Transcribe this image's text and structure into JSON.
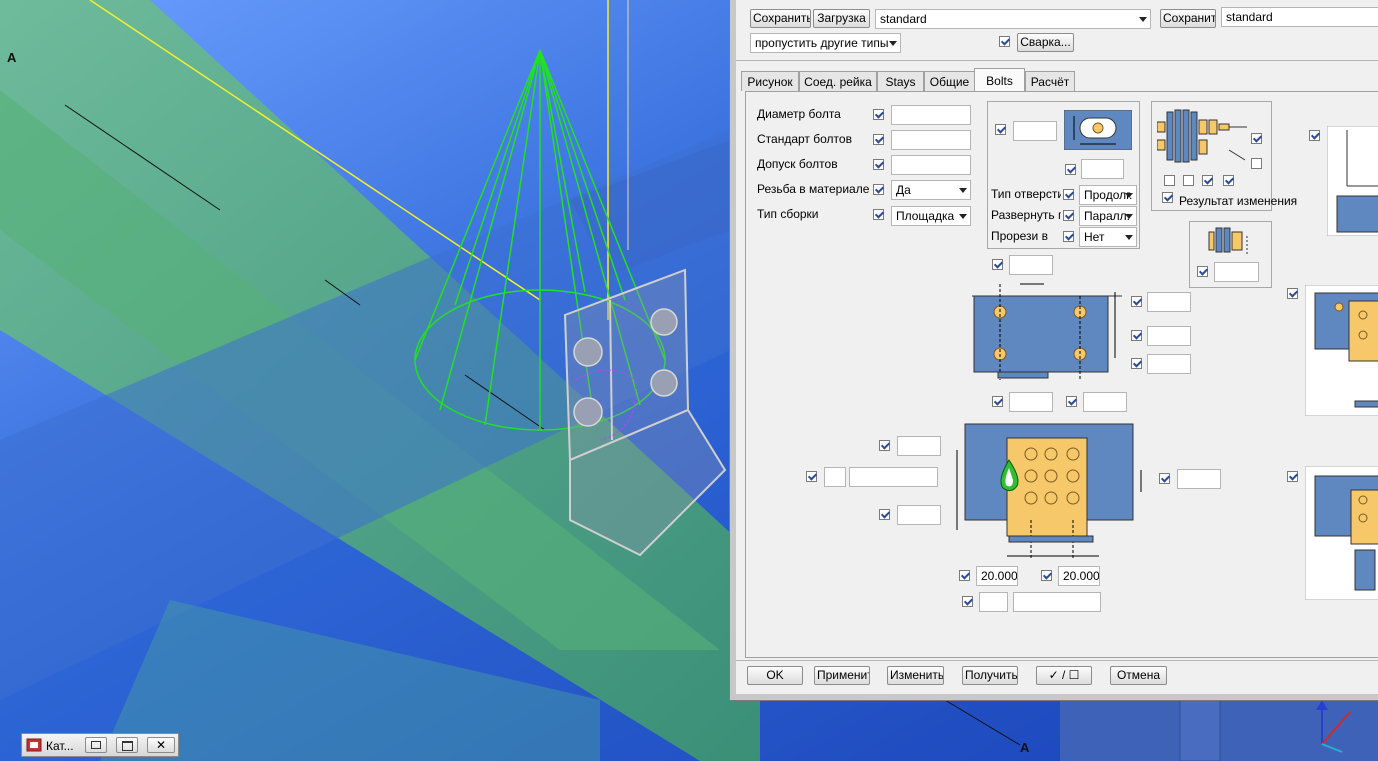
{
  "viewport": {
    "axis_label_top": "A",
    "axis_label_bottom": "A"
  },
  "dialog": {
    "toolbar": {
      "save_label": "Сохранить",
      "load_label": "Загрузка",
      "preset_value": "standard",
      "save_as_label": "Сохранить как",
      "save_as_value": "standard",
      "skip_types_value": "пропустить другие типы",
      "weld_label": "Сварка..."
    },
    "tabs": [
      {
        "label": "Рисунок"
      },
      {
        "label": "Соед. рейка"
      },
      {
        "label": "Stays"
      },
      {
        "label": "Общие"
      },
      {
        "label": "Bolts",
        "active": true
      },
      {
        "label": "Расчёт"
      }
    ],
    "bolts": {
      "rows": [
        {
          "label": "Диаметр болта",
          "value": ""
        },
        {
          "label": "Стандарт болтов",
          "value": ""
        },
        {
          "label": "Допуск болтов",
          "value": ""
        },
        {
          "label": "Резьба в материале",
          "value": "Да"
        },
        {
          "label": "Тип сборки",
          "value": "Площадка"
        }
      ],
      "hole_group": [
        {
          "label": "Тип отверстий",
          "value": "Продолг."
        },
        {
          "label": "Развернуть паз",
          "value": "Паралл."
        },
        {
          "label": "Прорези в",
          "value": "Нет"
        }
      ],
      "result_label": "Результат изменения",
      "spacing_left": "20.000",
      "spacing_right": "20.000"
    },
    "footer": {
      "ok_label": "OK",
      "apply_label": "Применить",
      "modify_label": "Изменить",
      "get_label": "Получить",
      "toggle_label": "✓ / ☐",
      "cancel_label": "Отмена"
    }
  },
  "taskbar": {
    "window_label": "Кат..."
  },
  "colors": {
    "viewport_blue": "#2a5fd0",
    "beam_green": "#4aa86a",
    "plate_blue": "#5f87c0",
    "plate_yellow": "#f6c86a",
    "wire_green": "#22e022"
  }
}
